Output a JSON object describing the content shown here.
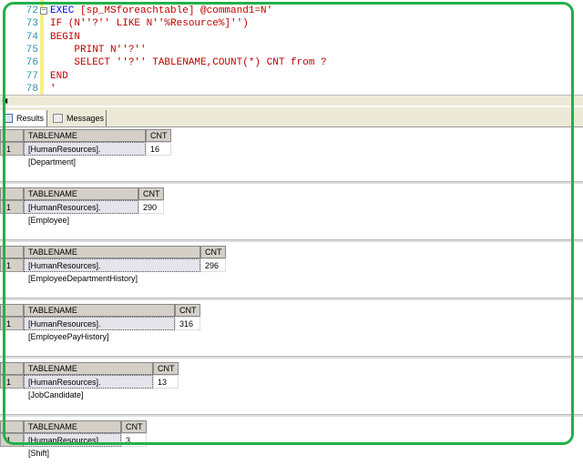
{
  "editor": {
    "lines": [
      {
        "num": "72",
        "kw": "EXEC",
        "code": " [sp_MSforeachtable] @command1=N'"
      },
      {
        "num": "73",
        "kw": "",
        "code": "IF (N''?'' LIKE N''%Resource%]'')"
      },
      {
        "num": "74",
        "kw": "",
        "code": "BEGIN"
      },
      {
        "num": "75",
        "kw": "",
        "code": "    PRINT N''?''"
      },
      {
        "num": "76",
        "kw": "",
        "code": "    SELECT ''?'' TABLENAME,COUNT(*) CNT from ?"
      },
      {
        "num": "77",
        "kw": "",
        "code": "END"
      },
      {
        "num": "78",
        "kw": "",
        "code": "'"
      }
    ]
  },
  "tabs": [
    {
      "label": "Results"
    },
    {
      "label": "Messages"
    }
  ],
  "results": [
    {
      "col1": "TABLENAME",
      "col2": "CNT",
      "row": "1",
      "tablename": "[HumanResources].[Department]",
      "cnt": "16"
    },
    {
      "col1": "TABLENAME",
      "col2": "CNT",
      "row": "1",
      "tablename": "[HumanResources].[Employee]",
      "cnt": "290"
    },
    {
      "col1": "TABLENAME",
      "col2": "CNT",
      "row": "1",
      "tablename": "[HumanResources].[EmployeeDepartmentHistory]",
      "cnt": "296"
    },
    {
      "col1": "TABLENAME",
      "col2": "CNT",
      "row": "1",
      "tablename": "[HumanResources].[EmployeePayHistory]",
      "cnt": "316"
    },
    {
      "col1": "TABLENAME",
      "col2": "CNT",
      "row": "1",
      "tablename": "[HumanResources].[JobCandidate]",
      "cnt": "13"
    },
    {
      "col1": "TABLENAME",
      "col2": "CNT",
      "row": "1",
      "tablename": "[HumanResources].[Shift]",
      "cnt": "3"
    }
  ],
  "colors": {
    "highlight_frame": "#22b04b",
    "string": "#c00000",
    "keyword": "#0000ff",
    "line_number": "#2b91af"
  }
}
